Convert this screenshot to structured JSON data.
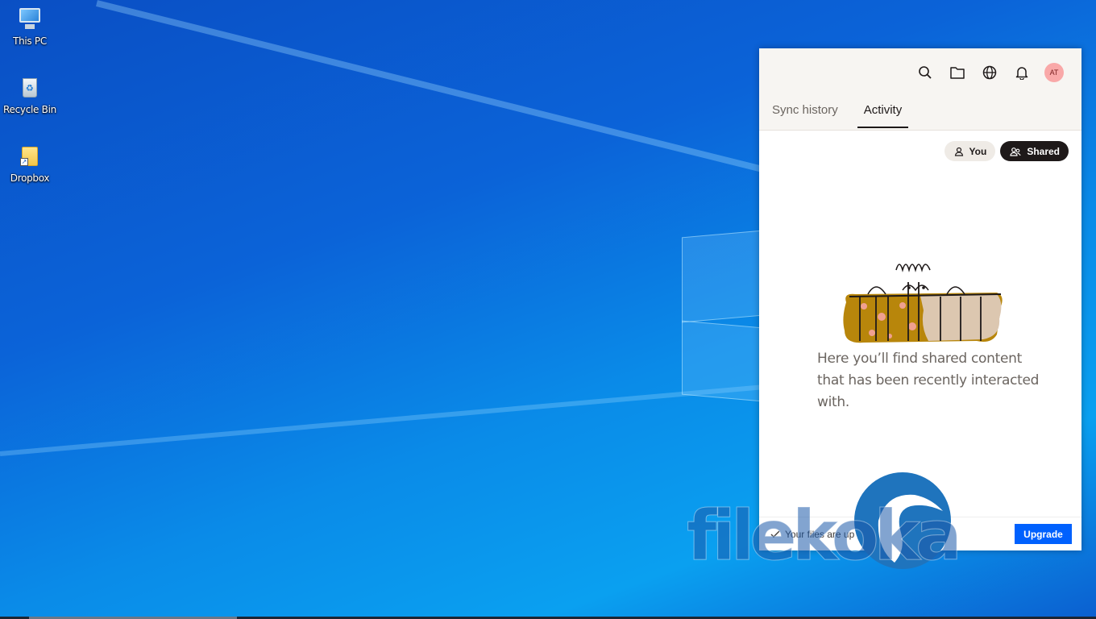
{
  "desktop": {
    "icons": [
      {
        "label": "This PC",
        "icon": "computer-icon"
      },
      {
        "label": "Recycle Bin",
        "icon": "recycle-bin-icon"
      },
      {
        "label": "Dropbox",
        "icon": "folder-shortcut-icon"
      }
    ]
  },
  "panel": {
    "header_icons": [
      "search-icon",
      "folder-icon",
      "globe-icon",
      "bell-icon"
    ],
    "avatar_initials": "AT",
    "tabs": [
      {
        "label": "Sync history",
        "active": false
      },
      {
        "label": "Activity",
        "active": true
      }
    ],
    "filters": [
      {
        "label": "You",
        "selected": false,
        "icon": "person-icon"
      },
      {
        "label": "Shared",
        "selected": true,
        "icon": "people-icon"
      }
    ],
    "empty_state_text": "Here you’ll find shared content that has been recently interacted with.",
    "footer": {
      "status_text": "Your files are up to date",
      "upgrade_label": "Upgrade"
    }
  },
  "watermark": {
    "text": "filekoka"
  },
  "colors": {
    "accent": "#0061fe",
    "dark_pill": "#1e1919",
    "avatar_bg": "#f9a8a8",
    "header_bg": "#f7f5f2"
  }
}
